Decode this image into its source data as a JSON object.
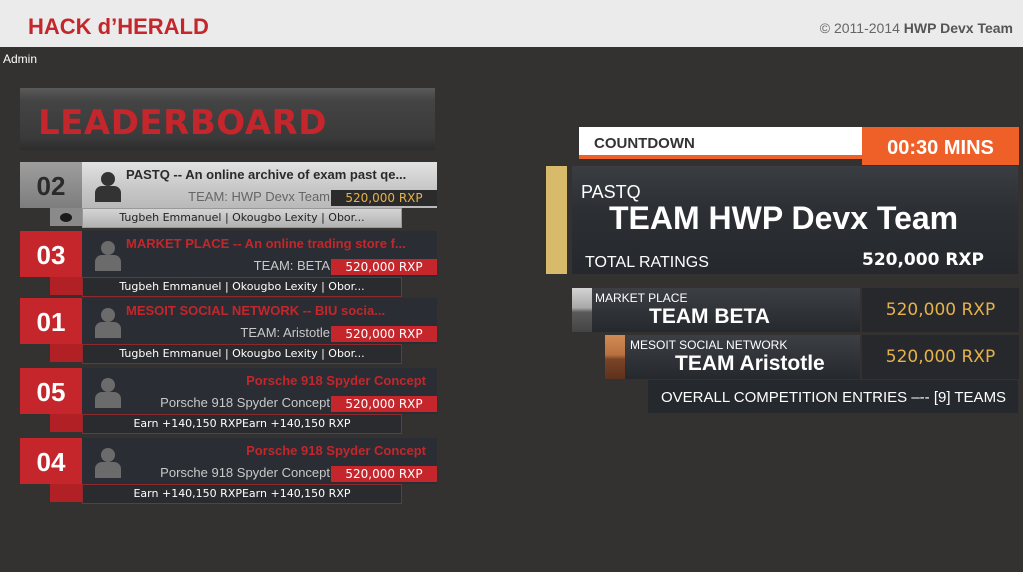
{
  "header": {
    "brand": "HACK d’HERALD",
    "copyright_prefix": "© 2011-2014 ",
    "copyright_team": "HWP Devx Team"
  },
  "user": {
    "role": "Admin"
  },
  "leaderboard": {
    "title": "LEADERBOARD",
    "entries": [
      {
        "rank": "02",
        "title": "PASTQ -- An online archive of exam past qe...",
        "team": "TEAM: HWP Devx Team",
        "xp": "520,000 RXP",
        "members": "Tugbeh Emmanuel | Okougbo Lexity | Obor..."
      },
      {
        "rank": "03",
        "title": "MARKET PLACE -- An online trading store f...",
        "team": "TEAM: BETA",
        "xp": "520,000 RXP",
        "members": "Tugbeh Emmanuel | Okougbo Lexity | Obor..."
      },
      {
        "rank": "01",
        "title": "MESOIT SOCIAL NETWORK --  BIU socia...",
        "team": "TEAM: Aristotle",
        "xp": "520,000 RXP",
        "members": "Tugbeh Emmanuel | Okougbo Lexity | Obor..."
      },
      {
        "rank": "05",
        "title": "Porsche 918 Spyder Concept",
        "team": "Porsche 918 Spyder Concept",
        "xp": "520,000 RXP",
        "members": "Earn +140,150 RXPEarn +140,150 RXP"
      },
      {
        "rank": "04",
        "title": "Porsche 918 Spyder Concept",
        "team": "Porsche 918 Spyder Concept",
        "xp": "520,000 RXP",
        "members": "Earn +140,150 RXPEarn +140,150 RXP"
      }
    ]
  },
  "countdown": {
    "label": "COUNTDOWN",
    "time": "00:30 MINS"
  },
  "featured": {
    "project": "PASTQ",
    "team": "TEAM HWP Devx Team",
    "ratings_label": "TOTAL RATINGS",
    "xp": "520,000 RXP",
    "accent": "#d8ba6b"
  },
  "runners_up": [
    {
      "project": "MARKET PLACE",
      "team": "TEAM BETA",
      "xp": "520,000 RXP",
      "accent": "#b8b8b8"
    },
    {
      "project": "MESOIT SOCIAL NETWORK",
      "team": "TEAM Aristotle",
      "xp": "520,000 RXP",
      "accent": "#c07a4a"
    }
  ],
  "overall": "OVERALL COMPETITION ENTRIES –-- [9] TEAMS",
  "colors": {
    "brand_red": "#c4262b",
    "countdown_orange": "#ef5f28",
    "gold_text": "#e6b24a",
    "background": "#343231"
  },
  "icons": {
    "team_avatar": "user-silhouette-icon"
  }
}
